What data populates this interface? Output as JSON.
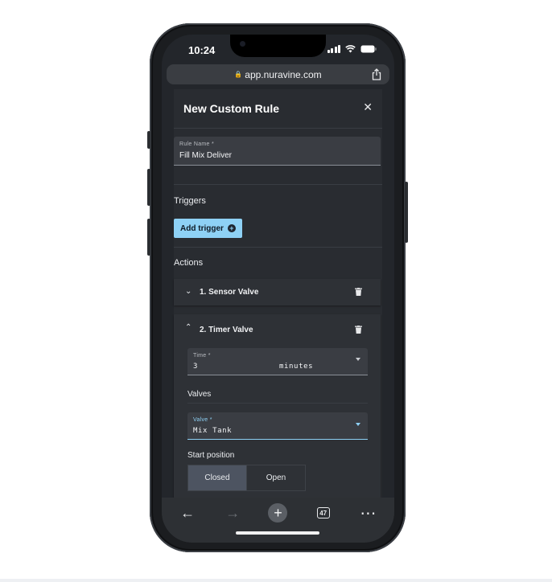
{
  "status_bar": {
    "time": "10:24"
  },
  "browser": {
    "url": "app.nuravine.com",
    "tab_count": "47"
  },
  "modal": {
    "title": "New Custom Rule",
    "rule_name": {
      "label": "Rule Name *",
      "value": "Fill Mix Deliver"
    },
    "triggers": {
      "heading": "Triggers",
      "add_label": "Add trigger"
    },
    "actions": {
      "heading": "Actions",
      "items": [
        {
          "title": "1. Sensor Valve",
          "expanded": false
        },
        {
          "title": "2. Timer Valve",
          "expanded": true,
          "time": {
            "label": "Time *",
            "value": "3",
            "unit": "minutes"
          },
          "valves_heading": "Valves",
          "valve": {
            "label": "Valve *",
            "value": "Mix Tank"
          },
          "start_position": {
            "label": "Start position",
            "options": [
              "Closed",
              "Open"
            ],
            "selected": "Closed"
          }
        }
      ]
    }
  },
  "colors": {
    "accent": "#8ed1f5",
    "surface": "#292c31",
    "screen": "#23262b"
  }
}
